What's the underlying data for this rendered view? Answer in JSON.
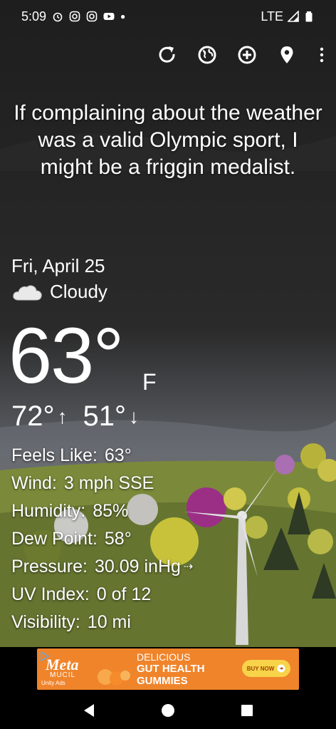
{
  "status_bar": {
    "time": "5:09",
    "network": "LTE"
  },
  "toolbar": {
    "icons": [
      "refresh-icon",
      "globe-icon",
      "add-circle-icon",
      "location-pin-icon",
      "more-vert-icon"
    ]
  },
  "quote": "If complaining about the weather was a valid Olympic sport, I might be a friggin medalist.",
  "weather": {
    "date": "Fri, April 25",
    "condition": "Cloudy",
    "temperature": "63°",
    "unit": "F",
    "high": "72°",
    "low": "51°"
  },
  "details": [
    {
      "label": "Feels Like:",
      "value": "63°"
    },
    {
      "label": "Wind:",
      "value": "3 mph SSE"
    },
    {
      "label": "Humidity:",
      "value": "85%"
    },
    {
      "label": "Dew Point:",
      "value": "58°"
    },
    {
      "label": "Pressure:",
      "value": "30.09 inHg"
    },
    {
      "label": "UV Index:",
      "value": "0 of 12"
    },
    {
      "label": "Visibility:",
      "value": "10 mi"
    }
  ],
  "ad": {
    "brand": "Meta",
    "sub": "MUCIL",
    "network": "Unity Ads",
    "headline1": "DELICIOUS",
    "headline2": "GUT HEALTH",
    "headline3": "GUMMIES",
    "cta": "BUY NOW"
  },
  "colors": {
    "ad_bg": "#f0842b",
    "sky_top": "#1f1f1f",
    "hill": "#5a6b2e"
  }
}
